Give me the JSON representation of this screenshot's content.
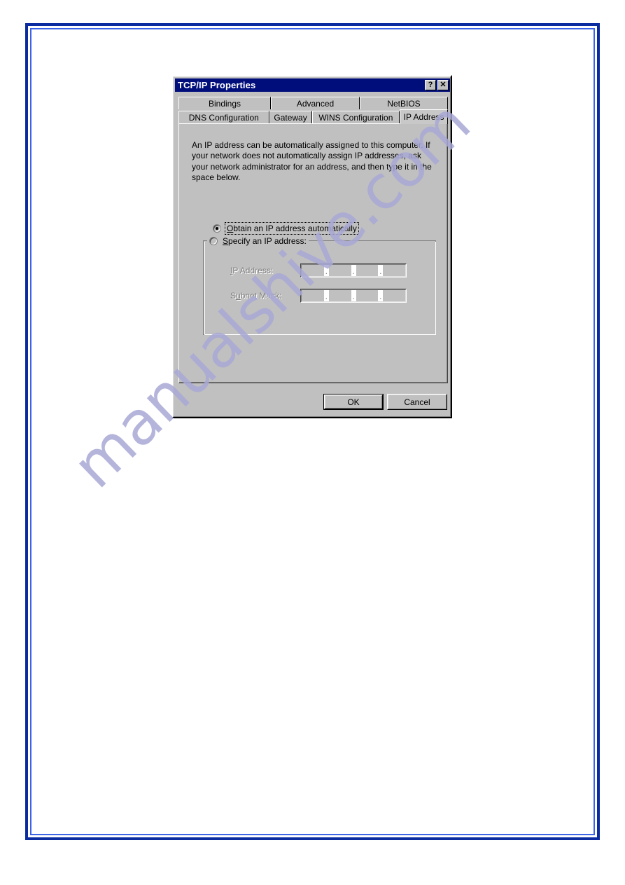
{
  "page": {
    "frame_color_outer": "#0a2ca0",
    "frame_color_inner": "#3a63e8",
    "background": "#ffffff"
  },
  "watermark": {
    "text": "manualshive.com",
    "color": "#a9a9d6"
  },
  "dialog": {
    "title": "TCP/IP Properties",
    "titlebar_color": "#000e7c",
    "face_color": "#c0c0c0",
    "titlebar_buttons": [
      {
        "name": "help-button",
        "glyph": "?"
      },
      {
        "name": "close-button",
        "glyph": "✕"
      }
    ],
    "tabs": {
      "row1": [
        {
          "label": "Bindings",
          "active": false
        },
        {
          "label": "Advanced",
          "active": false
        },
        {
          "label": "NetBIOS",
          "active": false
        }
      ],
      "row2": [
        {
          "label": "DNS Configuration",
          "active": false
        },
        {
          "label": "Gateway",
          "active": false
        },
        {
          "label": "WINS Configuration",
          "active": false
        },
        {
          "label": "IP Address",
          "active": true
        }
      ],
      "selected": "IP Address"
    },
    "ip_address_page": {
      "description": "An IP address can be automatically assigned to this computer. If your network does not automatically assign IP addresses, ask your network administrator for an address, and then type it in the space below.",
      "radio_obtain": {
        "accel": "O",
        "rest": "btain an IP address automatically",
        "checked": true,
        "focused": true
      },
      "radio_specify": {
        "accel": "S",
        "rest": "pecify an IP address:",
        "checked": false,
        "focused": false
      },
      "fields": [
        {
          "name": "ip-address",
          "accel": "I",
          "label_rest": "P Address:",
          "enabled": false,
          "octets": [
            "",
            "",
            "",
            ""
          ],
          "separator": "."
        },
        {
          "name": "subnet-mask",
          "accel": "u",
          "label_prefix": "S",
          "label_rest": "bnet Mask:",
          "enabled": false,
          "octets": [
            "",
            "",
            "",
            ""
          ],
          "separator": "."
        }
      ]
    },
    "buttons": [
      {
        "name": "ok-button",
        "label": "OK",
        "default": true
      },
      {
        "name": "cancel-button",
        "label": "Cancel",
        "default": false
      }
    ]
  }
}
